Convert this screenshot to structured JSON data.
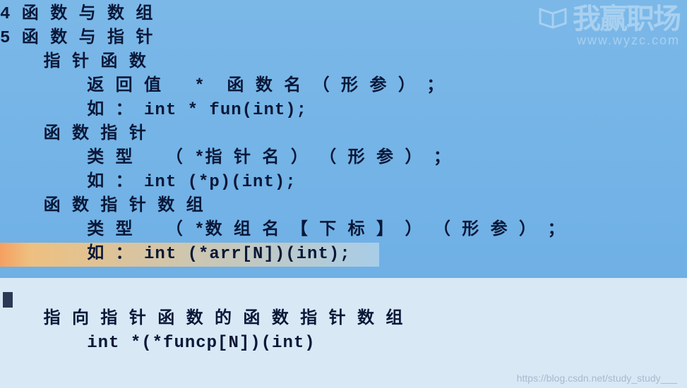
{
  "watermarkTop": {
    "brand": "我赢职场",
    "url": "www.wyzc.com"
  },
  "watermarkBottom": "https://blog.csdn.net/study_study___",
  "lines": {
    "l1": "4 函 数 与 数 组",
    "l2": "5 函 数 与 指 针",
    "l3": "    指 针 函 数",
    "l4": "        返 回 值   *  函 数 名 （ 形 参 ） ；",
    "l5": "        如 ： int * fun(int);",
    "l6": "    函 数 指 针",
    "l7": "        类 型   （ *指 针 名 ） （ 形 参 ） ；",
    "l8": "        如 ： int (*p)(int);",
    "l9": "    函 数 指 针 数 组",
    "l10": "        类 型   （ *数 组 名 【 下 标 】 ） （ 形 参 ） ；",
    "l11": "        如 ： int (*arr[N])(int);",
    "l12": "    指 向 指 针 函 数 的 函 数 指 针 数 组",
    "l13": "        int *(*funcp[N])(int)"
  }
}
